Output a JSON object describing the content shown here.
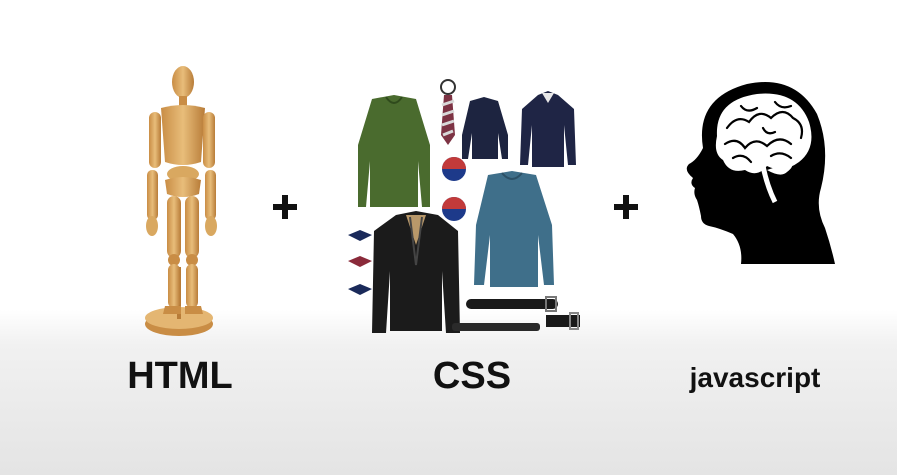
{
  "slide": {
    "operator": "+",
    "items": [
      {
        "label": "HTML",
        "image": "wooden-mannequin"
      },
      {
        "label": "CSS",
        "image": "clothing-flatlay"
      },
      {
        "label": "javascript",
        "image": "brain-head-silhouette"
      }
    ]
  },
  "colors": {
    "background_top": "#ffffff",
    "background_bottom": "#e4e4e4",
    "text": "#111111",
    "wood": "#d9a860",
    "sweater_green": "#4a6b2e",
    "sweater_blue": "#3f6f8a",
    "navy": "#1d2440",
    "suit": "#1b1b1b"
  }
}
